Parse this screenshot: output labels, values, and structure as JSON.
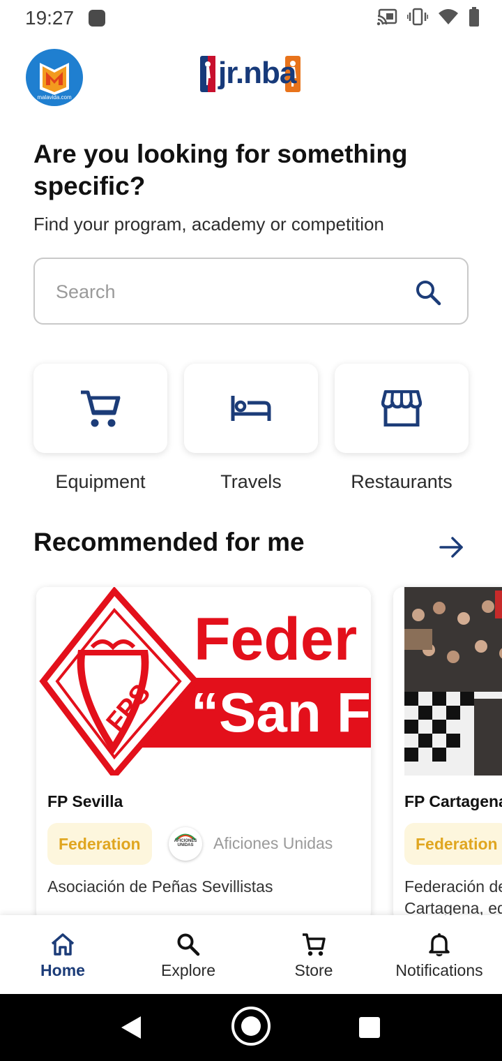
{
  "status_bar": {
    "time": "19:27",
    "icons": [
      "cast-icon",
      "vibrate-icon",
      "wifi-icon",
      "battery-icon"
    ]
  },
  "header": {
    "left_logo_caption": "malavida.com",
    "brand_logo_text": "jr.nba"
  },
  "hero": {
    "title": "Are you looking for something specific?",
    "subtitle": "Find your program, academy or competition"
  },
  "search": {
    "placeholder": "Search",
    "value": ""
  },
  "categories": [
    {
      "label": "Equipment",
      "icon": "cart-icon"
    },
    {
      "label": "Travels",
      "icon": "bed-icon"
    },
    {
      "label": "Restaurants",
      "icon": "store-icon"
    }
  ],
  "recommended": {
    "title": "Recommended for me",
    "cards": [
      {
        "name": "FP Sevilla",
        "badge": "Federation",
        "org_logo_text": "AFICIONES UNIDAS",
        "org_name": "Aficiones Unidas",
        "description": "Asociación de Peñas Sevillistas",
        "image_text_1": "Feder",
        "image_text_2": "“San Fe",
        "image_monogram": "FPS"
      },
      {
        "name": "FP Cartagena",
        "badge": "Federation",
        "description_line1": "Federación de",
        "description_line2": "Cartagena, eq"
      }
    ]
  },
  "bottom_nav": [
    {
      "label": "Home",
      "icon": "home-icon",
      "active": true
    },
    {
      "label": "Explore",
      "icon": "search-icon",
      "active": false
    },
    {
      "label": "Store",
      "icon": "cart-icon",
      "active": false
    },
    {
      "label": "Notifications",
      "icon": "bell-icon",
      "active": false
    }
  ],
  "colors": {
    "primary": "#1c3c78",
    "badge_bg": "#fdf6dd",
    "badge_text": "#e0a620",
    "fps_red": "#e3101b"
  }
}
